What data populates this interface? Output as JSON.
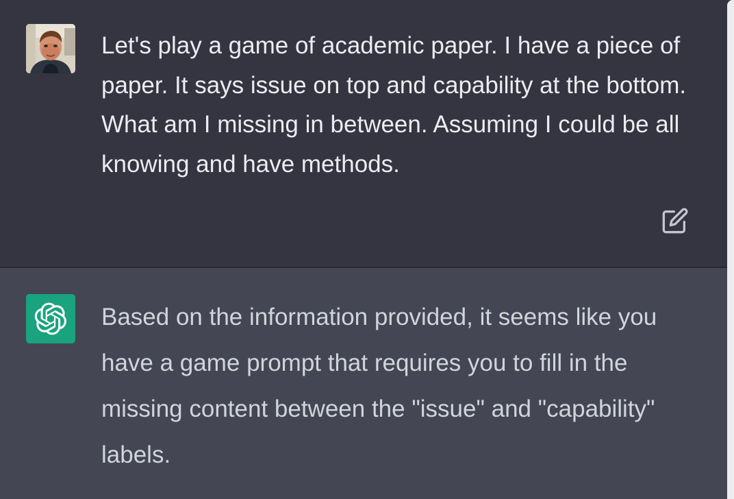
{
  "conversation": {
    "user_message": {
      "avatar_icon": "user-avatar-photo",
      "text": "Let's play a game of academic paper. I have a piece of paper. It says issue on top and capability at the bottom. What am I missing in between. Assuming I could be all knowing and have methods.",
      "edit_icon": "edit-icon"
    },
    "assistant_message": {
      "avatar_icon": "openai-logo-icon",
      "text": "Based on the information provided, it seems like you have a game prompt that requires you to fill in the missing content between the \"issue\" and \"capability\" labels."
    }
  },
  "colors": {
    "user_bg": "#343541",
    "assistant_bg": "#444654",
    "gpt_avatar_bg": "#19a37e",
    "user_text": "#ececf1",
    "assistant_text": "#d1d5db",
    "scrollbar": "#ececf1"
  }
}
